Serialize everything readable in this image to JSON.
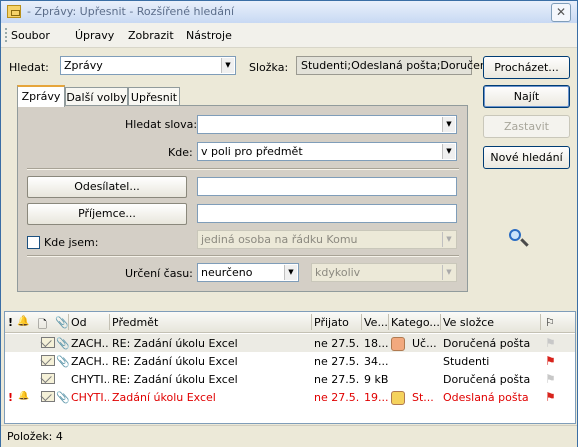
{
  "window": {
    "title": "- Zprávy: Upřesnit - Rozšířené hledání",
    "close_glyph": "✕"
  },
  "menu": [
    {
      "label": "Soubor"
    },
    {
      "label": "Úpravy"
    },
    {
      "label": "Zobrazit"
    },
    {
      "label": "Nástroje"
    }
  ],
  "search": {
    "find_label": "Hledat:",
    "find_value": "Zprávy",
    "folder_label": "Složka:",
    "folder_value": "Studenti;Odeslaná pošta;Doručená",
    "browse_button": "Procházet..."
  },
  "actions": {
    "find_now": "Najít",
    "stop": "Zastavit",
    "new_search": "Nové hledání"
  },
  "tabs": [
    {
      "label": "Zprávy"
    },
    {
      "label": "Další volby"
    },
    {
      "label": "Upřesnit"
    }
  ],
  "form": {
    "words_label": "Hledat slova:",
    "words_value": "",
    "where_label": "Kde:",
    "where_value": "v poli pro předmět",
    "from_button": "Odesílatel...",
    "from_value": "",
    "sent_to_button": "Příjemce...",
    "sent_to_value": "",
    "where_i_am_label": "Kde jsem:",
    "where_i_am_checked": false,
    "where_i_am_value": "jediná osoba na řádku Komu",
    "time_label": "Určení času:",
    "time_value": "neurčeno",
    "time_range_value": "kdykoliv"
  },
  "results": {
    "columns": [
      "!",
      "Od",
      "Předmět",
      "Přijato",
      "Ve...",
      "Katego...",
      "Ve složce"
    ],
    "rows": [
      {
        "from": "ZACH...",
        "subject": "RE: Zadání úkolu Excel",
        "received": "ne 27.5....",
        "size": "18...",
        "category": "Uč...",
        "category_color": "#f2a97e",
        "folder": "Doručená pošta",
        "attach": true,
        "flag": "white",
        "red": false,
        "selected": true
      },
      {
        "from": "ZACH...",
        "subject": "RE: Zadání úkolu Excel",
        "received": "ne 27.5....",
        "size": "34...",
        "category": "",
        "category_color": "",
        "folder": "Studenti",
        "attach": true,
        "flag": "red",
        "red": false,
        "selected": false
      },
      {
        "from": "CHYTI...",
        "subject": "RE: Zadání úkolu Excel",
        "received": "ne 27.5....",
        "size": "9 kB",
        "category": "",
        "category_color": "",
        "folder": "Doručená pošta",
        "attach": false,
        "flag": "white",
        "red": false,
        "selected": false
      },
      {
        "from": "CHYTI...",
        "subject": "Zadání úkolu Excel",
        "received": "ne 27.5....",
        "size": "19...",
        "category": "St...",
        "category_color": "#f5d25c",
        "folder": "Odeslaná pošta",
        "attach": true,
        "flag": "red",
        "red": true,
        "selected": false
      }
    ]
  },
  "status": {
    "count_label": "Položek: 4"
  },
  "colors": {
    "red_text": "#e00000",
    "panel": "#d4cfc6",
    "window": "#ece9d8"
  }
}
